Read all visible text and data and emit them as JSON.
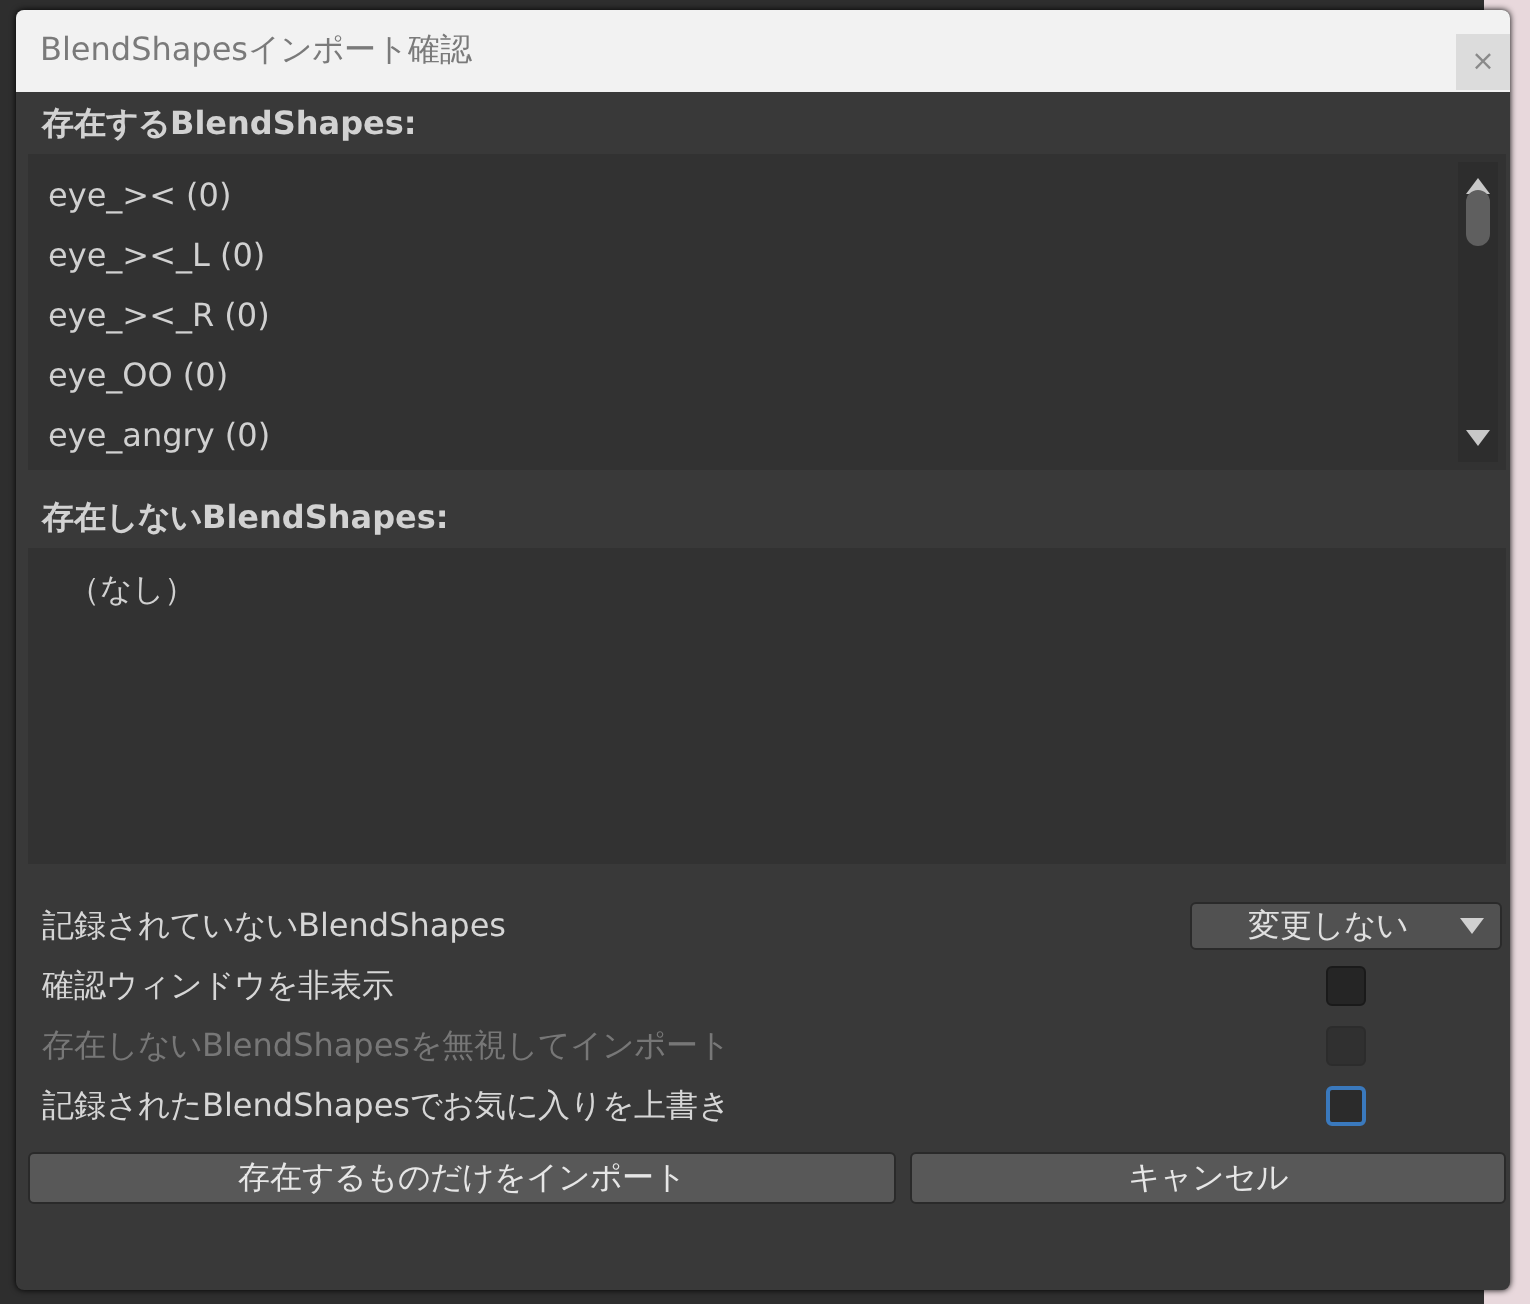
{
  "window": {
    "title": "BlendShapesインポート確認",
    "close": "×"
  },
  "existing": {
    "label": "存在するBlendShapes:",
    "items": [
      "eye_>< (0)",
      "eye_><_L (0)",
      "eye_><_R (0)",
      "eye_OO (0)",
      "eye_angry (0)"
    ]
  },
  "missing": {
    "label": "存在しないBlendShapes:",
    "items": [
      "（なし）"
    ]
  },
  "options": [
    {
      "kind": "dropdown",
      "label": "記録されていないBlendShapes",
      "value": "変更しない",
      "disabled": false
    },
    {
      "kind": "checkbox",
      "label": "確認ウィンドウを非表示",
      "checked": false,
      "disabled": false,
      "focused": false
    },
    {
      "kind": "checkbox",
      "label": "存在しないBlendShapesを無視してインポート",
      "checked": false,
      "disabled": true,
      "focused": false
    },
    {
      "kind": "checkbox",
      "label": "記録されたBlendShapesでお気に入りを上書き",
      "checked": false,
      "disabled": false,
      "focused": true
    }
  ],
  "buttons": [
    "存在するものだけをインポート",
    "キャンセル"
  ]
}
